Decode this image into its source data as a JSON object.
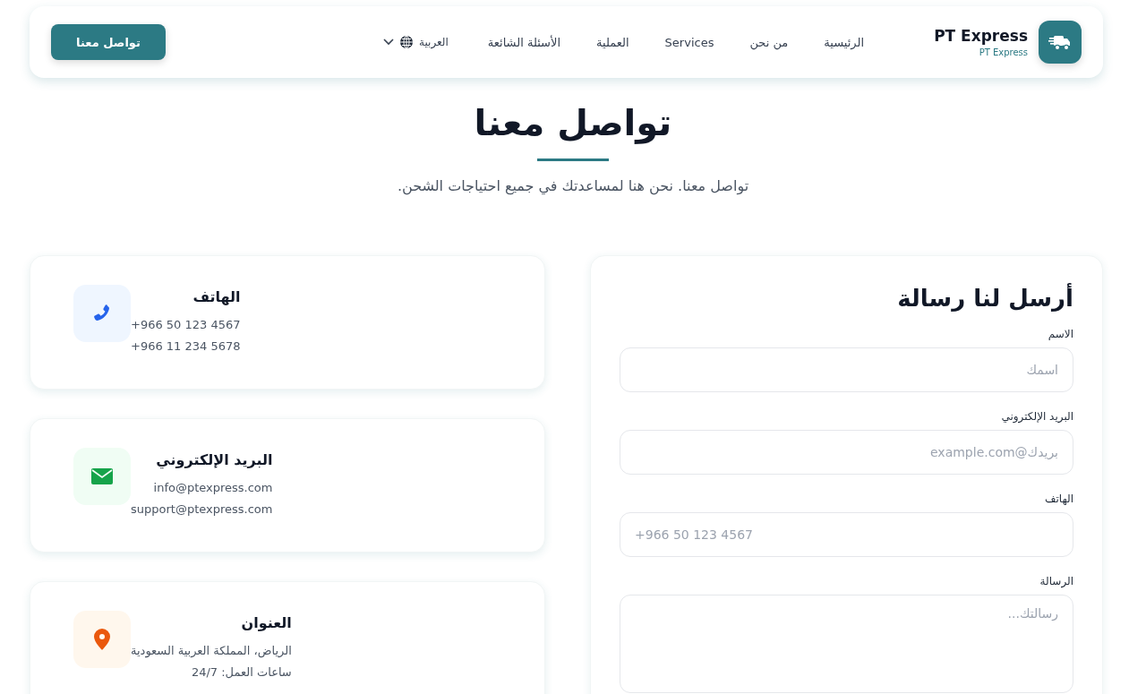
{
  "header": {
    "brand": {
      "name": "PT Express",
      "tagline": "PT Express"
    },
    "nav": [
      {
        "label": "الرئيسية"
      },
      {
        "label": "من نحن"
      },
      {
        "label": "Services"
      },
      {
        "label": "العملية"
      },
      {
        "label": "الأسئلة الشائعة"
      }
    ],
    "language": "العربية",
    "cta": "تواصل معنا"
  },
  "hero": {
    "title": "تواصل معنا",
    "subtitle": "تواصل معنا. نحن هنا لمساعدتك في جميع احتياجات الشحن."
  },
  "form": {
    "title": "أرسل لنا رسالة",
    "fields": [
      {
        "kind": "input",
        "label": "الاسم",
        "placeholder": "اسمك"
      },
      {
        "kind": "input",
        "label": "البريد الإلكتروني",
        "placeholder": "بريدك@example.com"
      },
      {
        "kind": "phone",
        "label": "الهاتف",
        "placeholder": "+966 50 123 4567"
      },
      {
        "kind": "textarea",
        "label": "الرسالة",
        "placeholder": "رسالتك..."
      }
    ]
  },
  "info_cards": [
    {
      "kind": "phone",
      "title": "الهاتف",
      "lines": [
        "+966 50 123 4567",
        "+966 11 234 5678"
      ]
    },
    {
      "kind": "email",
      "title": "البريد الإلكتروني",
      "lines": [
        "info@ptexpress.com",
        "support@ptexpress.com"
      ]
    },
    {
      "kind": "address",
      "title": "العنوان",
      "lines": [
        "الرياض، المملكة العربية السعودية",
        "ساعات العمل: 24/7"
      ]
    }
  ]
}
